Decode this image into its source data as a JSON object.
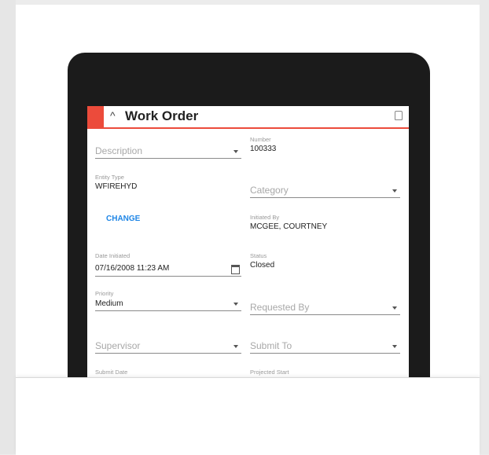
{
  "form": {
    "title": "Work Order",
    "description_placeholder": "Description",
    "number_label": "Number",
    "number_value": "100333",
    "entity_type_label": "Entity Type",
    "entity_type_value": "WFIREHYD",
    "category_placeholder": "Category",
    "change_label": "CHANGE",
    "initiated_by_label": "Initiated By",
    "initiated_by_value": "MCGEE, COURTNEY",
    "date_initiated_label": "Date Initiated",
    "date_initiated_value": "07/16/2008 11:23 AM",
    "status_label": "Status",
    "status_value": "Closed",
    "priority_label": "Priority",
    "priority_value": "Medium",
    "requested_by_placeholder": "Requested By",
    "supervisor_placeholder": "Supervisor",
    "submit_to_placeholder": "Submit To",
    "submit_date_label": "Submit Date",
    "projected_start_label": "Projected Start"
  },
  "colors": {
    "accent": "#ec4b3b",
    "link": "#1f86e6",
    "device": "#1b1b1b"
  },
  "icons": {
    "header": "chevron-up-icon",
    "lock": "lock-icon",
    "calendar": "calendar-icon",
    "dropdown": "dropdown-caret-icon"
  }
}
